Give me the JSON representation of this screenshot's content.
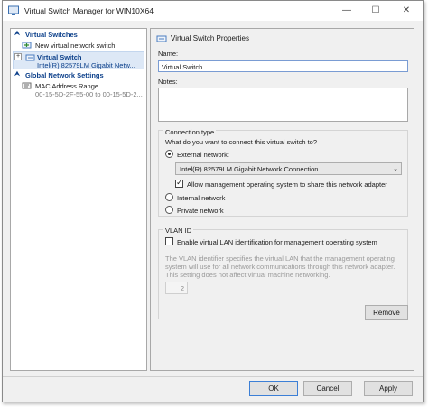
{
  "window": {
    "title": "Virtual Switch Manager for WIN10X64",
    "minimize": "—",
    "maximize": "☐",
    "close": "✕"
  },
  "left": {
    "virtual_switches_header": "Virtual Switches",
    "new_switch": "New virtual network switch",
    "switch_name": "Virtual Switch",
    "switch_adapter": "Intel(R) 82579LM Gigabit Netw...",
    "global_header": "Global Network Settings",
    "mac_label": "MAC Address Range",
    "mac_value": "00-15-5D-2F-55-00 to 00-15-5D-2..."
  },
  "right": {
    "properties_title": "Virtual Switch Properties",
    "name_label": "Name:",
    "name_value": "Virtual Switch",
    "notes_label": "Notes:",
    "connection_type_label": "Connection type",
    "connection_question": "What do you want to connect this virtual switch to?",
    "external_label": "External network:",
    "adapter_selected": "Intel(R) 82579LM Gigabit Network Connection",
    "allow_mgmt_label": "Allow management operating system to share this network adapter",
    "internal_label": "Internal network",
    "private_label": "Private network",
    "vlan_label": "VLAN ID",
    "vlan_enable_label": "Enable virtual LAN identification for management operating system",
    "vlan_help": "The VLAN identifier specifies the virtual LAN that the management operating system will use for all network communications through this network adapter. This setting does not affect virtual machine networking.",
    "vlan_value": "2",
    "remove_button": "Remove"
  },
  "footer": {
    "ok": "OK",
    "cancel": "Cancel",
    "apply": "Apply"
  },
  "colors": {
    "accent": "#0b3f8a",
    "selection": "#dde8f6",
    "focus_border": "#3c7fd6"
  }
}
